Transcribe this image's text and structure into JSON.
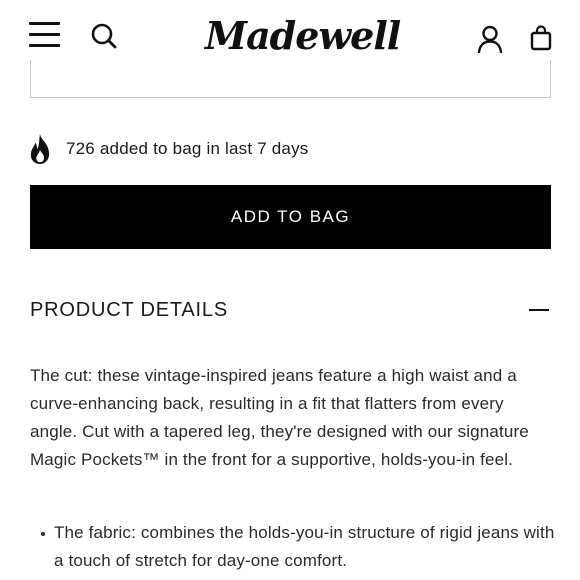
{
  "header": {
    "logo_text": "Madewell",
    "icons": {
      "menu": "hamburger-icon",
      "search": "search-icon",
      "account": "account-icon",
      "bag": "shopping-bag-icon"
    }
  },
  "social_proof": {
    "icon": "flame-icon",
    "text": "726 added to bag in last 7 days"
  },
  "actions": {
    "add_to_bag_label": "ADD TO BAG"
  },
  "product_details": {
    "title": "PRODUCT DETAILS",
    "toggle_icon": "collapse-minus-icon",
    "description": "The cut: these vintage-inspired jeans feature a high waist and a curve-enhancing back, resulting in a fit that flatters from every angle. Cut with a tapered leg, they're designed with our signature Magic Pockets™ in the front for a supportive, holds-you-in feel.",
    "bullets": [
      "The fabric: combines the holds-you-in structure of rigid jeans with a touch of stretch for day-one comfort."
    ]
  }
}
